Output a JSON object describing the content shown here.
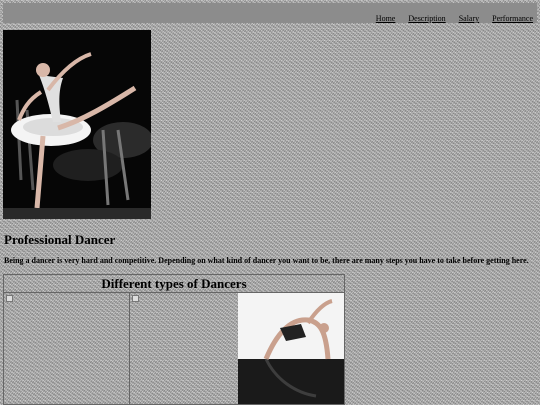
{
  "nav": {
    "items": [
      {
        "label": "Home"
      },
      {
        "label": "Description"
      },
      {
        "label": "Salary"
      },
      {
        "label": "Performance"
      }
    ]
  },
  "page": {
    "title": "Professional Dancer",
    "intro": "Being a dancer is very hard and competitive. Depending on what kind of dancer you want to be, there are many steps you have to take before getting here."
  },
  "types": {
    "heading": "Different types of Dancers"
  },
  "icons": {
    "broken_image": "broken-image-icon"
  }
}
